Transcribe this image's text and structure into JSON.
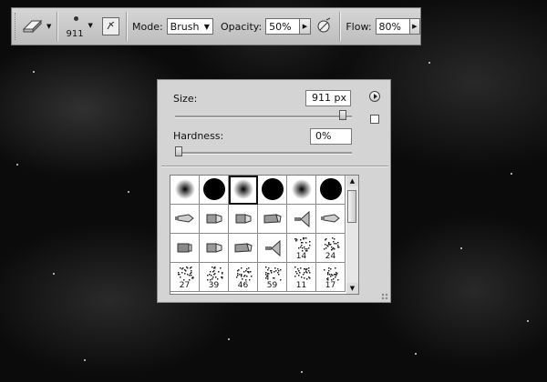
{
  "options_bar": {
    "tool_icon": "eraser-icon",
    "brush_size": "911",
    "panel_toggle_icon": "brush-panel-icon",
    "mode_label": "Mode:",
    "mode_value": "Brush",
    "opacity_label": "Opacity:",
    "opacity_value": "50%",
    "airbrush_icon": "airbrush-icon",
    "flow_label": "Flow:",
    "flow_value": "80%"
  },
  "brush_panel": {
    "size_label": "Size:",
    "size_value": "911 px",
    "size_slider_fraction": 0.97,
    "hardness_label": "Hardness:",
    "hardness_value": "0%",
    "hardness_slider_fraction": 0.0,
    "menu_icon": "panel-menu-icon",
    "new_preset_icon": "new-preset-icon",
    "presets": [
      {
        "kind": "soft-round",
        "label": ""
      },
      {
        "kind": "hard-round",
        "label": ""
      },
      {
        "kind": "soft-round",
        "label": "",
        "selected": true
      },
      {
        "kind": "hard-round",
        "label": ""
      },
      {
        "kind": "soft-round",
        "label": ""
      },
      {
        "kind": "hard-round",
        "label": ""
      },
      {
        "kind": "pencil",
        "label": ""
      },
      {
        "kind": "chisel",
        "label": ""
      },
      {
        "kind": "chisel",
        "label": ""
      },
      {
        "kind": "angled",
        "label": ""
      },
      {
        "kind": "fan",
        "label": ""
      },
      {
        "kind": "pencil",
        "label": ""
      },
      {
        "kind": "flat",
        "label": ""
      },
      {
        "kind": "chisel",
        "label": ""
      },
      {
        "kind": "angled",
        "label": ""
      },
      {
        "kind": "fan",
        "label": ""
      },
      {
        "kind": "scatter",
        "label": "14"
      },
      {
        "kind": "scatter",
        "label": "24"
      },
      {
        "kind": "scatter",
        "label": "27"
      },
      {
        "kind": "scatter",
        "label": "39"
      },
      {
        "kind": "scatter",
        "label": "46"
      },
      {
        "kind": "scatter",
        "label": "59"
      },
      {
        "kind": "scatter",
        "label": "11"
      },
      {
        "kind": "scatter",
        "label": "17"
      }
    ]
  }
}
